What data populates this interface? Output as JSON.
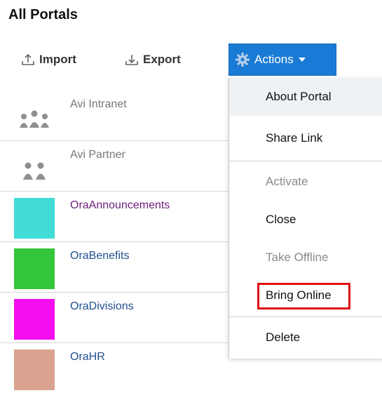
{
  "page": {
    "title": "All Portals"
  },
  "toolbar": {
    "import_label": "Import",
    "export_label": "Export",
    "actions_label": "Actions"
  },
  "portals": [
    {
      "name": "Avi Intranet",
      "thumb_color": "#9a9a9a",
      "icon": "people-group-icon"
    },
    {
      "name": "Avi Partner",
      "thumb_color": "#9a9a9a",
      "icon": "people-partner-icon"
    },
    {
      "name": "OraAnnouncements",
      "thumb_color": "#42dcd6"
    },
    {
      "name": "OraBenefits",
      "thumb_color": "#33c63a"
    },
    {
      "name": "OraDivisions",
      "thumb_color": "#f40ff0"
    },
    {
      "name": "OraHR",
      "thumb_color": "#d9a390"
    }
  ],
  "actions_menu": {
    "items": [
      {
        "label": "About Portal",
        "enabled": true
      },
      {
        "label": "Share Link",
        "enabled": true
      },
      {
        "label": "Activate",
        "enabled": false
      },
      {
        "label": "Close",
        "enabled": true
      },
      {
        "label": "Take Offline",
        "enabled": false
      },
      {
        "label": "Bring Online",
        "enabled": true,
        "highlighted": true
      },
      {
        "label": "Delete",
        "enabled": true
      }
    ]
  },
  "colors": {
    "actions_bg": "#1a7bd6",
    "highlight": "#e01010",
    "link_purple": "#6b1f7a",
    "link_blue": "#1f4f8f"
  }
}
